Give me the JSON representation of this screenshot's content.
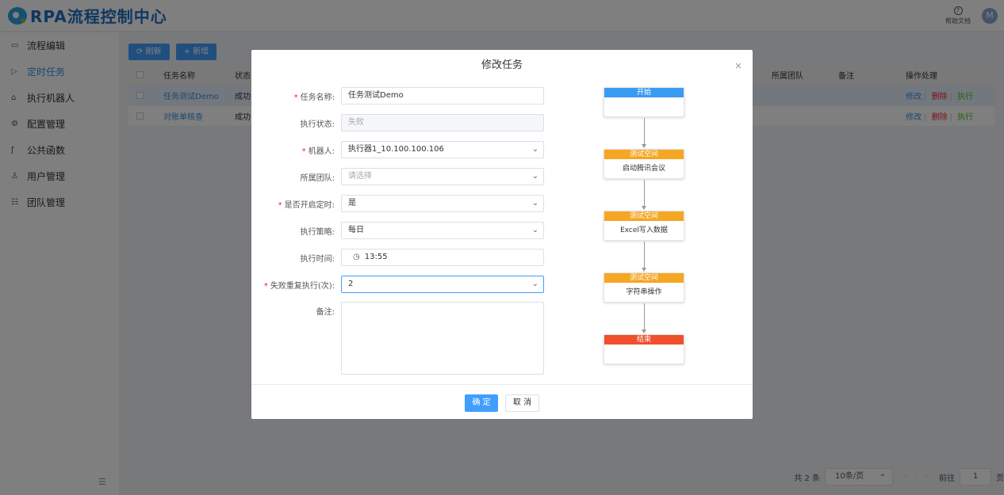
{
  "app": {
    "title": "RPA流程控制中心"
  },
  "header": {
    "help_label": "帮助文档",
    "help_icon": "?",
    "avatar_letter": "M"
  },
  "sidebar": {
    "items": [
      {
        "label": "流程编辑",
        "icon": "▭"
      },
      {
        "label": "定时任务",
        "icon": "▷"
      },
      {
        "label": "执行机器人",
        "icon": "⌂"
      },
      {
        "label": "配置管理",
        "icon": "⚙"
      },
      {
        "label": "公共函数",
        "icon": "ƒ"
      },
      {
        "label": "用户管理",
        "icon": "♙"
      },
      {
        "label": "团队管理",
        "icon": "☷"
      }
    ],
    "collapse_icon": "☰"
  },
  "toolbar": {
    "refresh_label": "⟳ 刷新",
    "add_label": "+ 新增"
  },
  "table": {
    "headers": {
      "name": "任务名称",
      "status": "状态",
      "team": "所属团队",
      "remark": "备注",
      "ops": "操作处理"
    },
    "rows": [
      {
        "name": "任务测试Demo",
        "status": "成功"
      },
      {
        "name": "对账单核查",
        "status": "成功"
      }
    ],
    "ops": {
      "edit": "修改",
      "delete": "删除",
      "execute": "执行",
      "sep": "|"
    }
  },
  "pagination": {
    "total": "共 2 条",
    "page_size": "10条/页",
    "goto_prefix": "前往",
    "page": "1",
    "goto_suffix": "页",
    "prev": "‹",
    "next": "›"
  },
  "modal": {
    "title": "修改任务",
    "close": "×",
    "fields": {
      "name": {
        "label": "任务名称:",
        "value": "任务测试Demo",
        "required": "*"
      },
      "exec_status": {
        "label": "执行状态:",
        "value": "失败"
      },
      "robot": {
        "label": "机器人:",
        "value": "执行器1_10.100.100.106",
        "required": "*"
      },
      "team": {
        "label": "所属团队:",
        "placeholder": "请选择"
      },
      "schedule_on": {
        "label": "是否开启定时:",
        "value": "是",
        "required": "*"
      },
      "strategy": {
        "label": "执行策略:",
        "value": "每日"
      },
      "exec_time": {
        "label": "执行时间:",
        "value": "13:55",
        "icon": "◷"
      },
      "retry": {
        "label": "失败重复执行(次):",
        "value": "2",
        "required": "*"
      },
      "remark": {
        "label": "备注:"
      }
    },
    "arrow": "⌄",
    "flow": [
      {
        "head": "开始",
        "body": "",
        "color": "#3a9bf3"
      },
      {
        "head": "测试空间",
        "body": "启动腾讯会议",
        "color": "#f5a623"
      },
      {
        "head": "测试空间",
        "body": "Excel写入数据",
        "color": "#f5a623"
      },
      {
        "head": "测试空间",
        "body": "字符串操作",
        "color": "#f5a623"
      },
      {
        "head": "结束",
        "body": "",
        "color": "#f0502d"
      }
    ],
    "ok_label": "确 定",
    "cancel_label": "取 消"
  }
}
